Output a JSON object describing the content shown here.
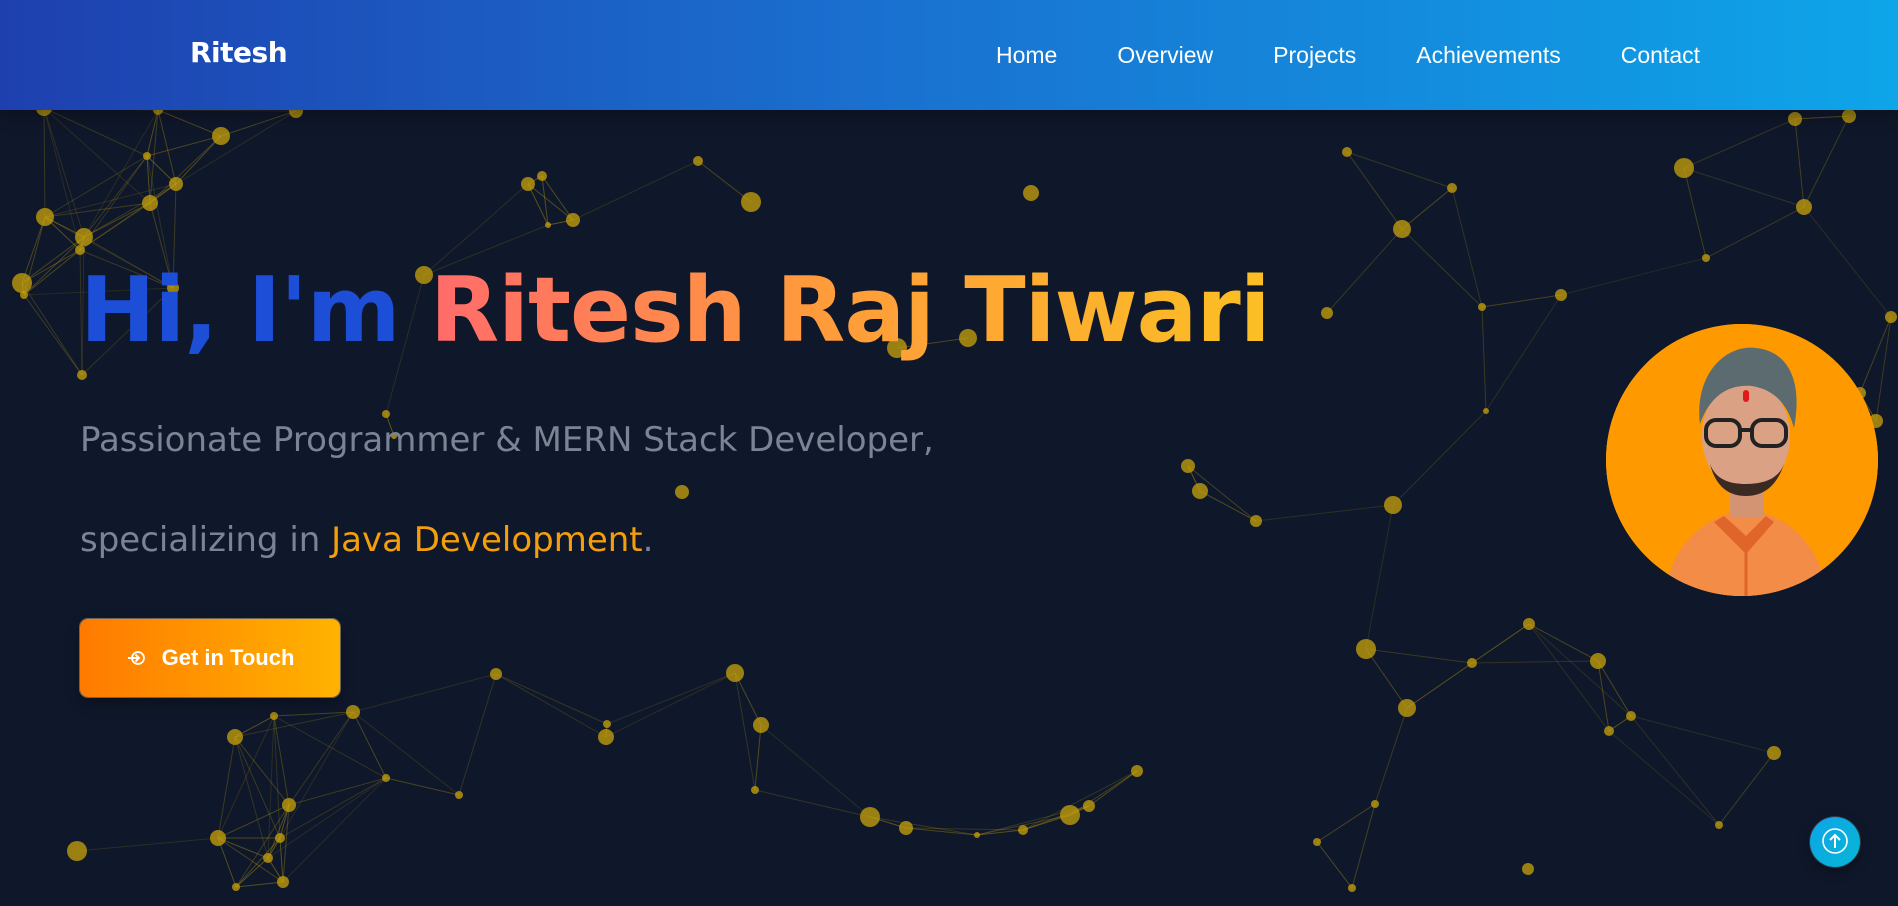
{
  "navbar": {
    "logo": "Ritesh",
    "links": [
      {
        "label": "Home"
      },
      {
        "label": "Overview"
      },
      {
        "label": "Projects"
      },
      {
        "label": "Achievements"
      },
      {
        "label": "Contact"
      }
    ]
  },
  "hero": {
    "greeting": "Hi, I'm ",
    "name": "Ritesh Raj Tiwari",
    "tagline_line1": "Passionate Programmer & MERN Stack Developer,",
    "tagline_line2_prefix": "specializing in ",
    "tagline_highlight": "Java Development",
    "tagline_line2_suffix": ".",
    "cta_label": "Get in Touch",
    "cta_icon": "arrow-right-circle-icon"
  },
  "profile": {
    "icon": "profile-photo"
  },
  "scroll_top": {
    "icon": "arrow-up-icon"
  },
  "colors": {
    "page_background": "#0f172a",
    "navbar_gradient_start": "#1e40af",
    "navbar_gradient_end": "#0ea5e9",
    "greeting": "#1d4ed8",
    "name_gradient_start": "#ff6b6b",
    "name_gradient_end": "#fbbf24",
    "highlight": "#f59e0b",
    "cta_gradient_start": "#ff7a00",
    "cta_gradient_end": "#ffb300",
    "network_nodes": "#c9a30b"
  }
}
